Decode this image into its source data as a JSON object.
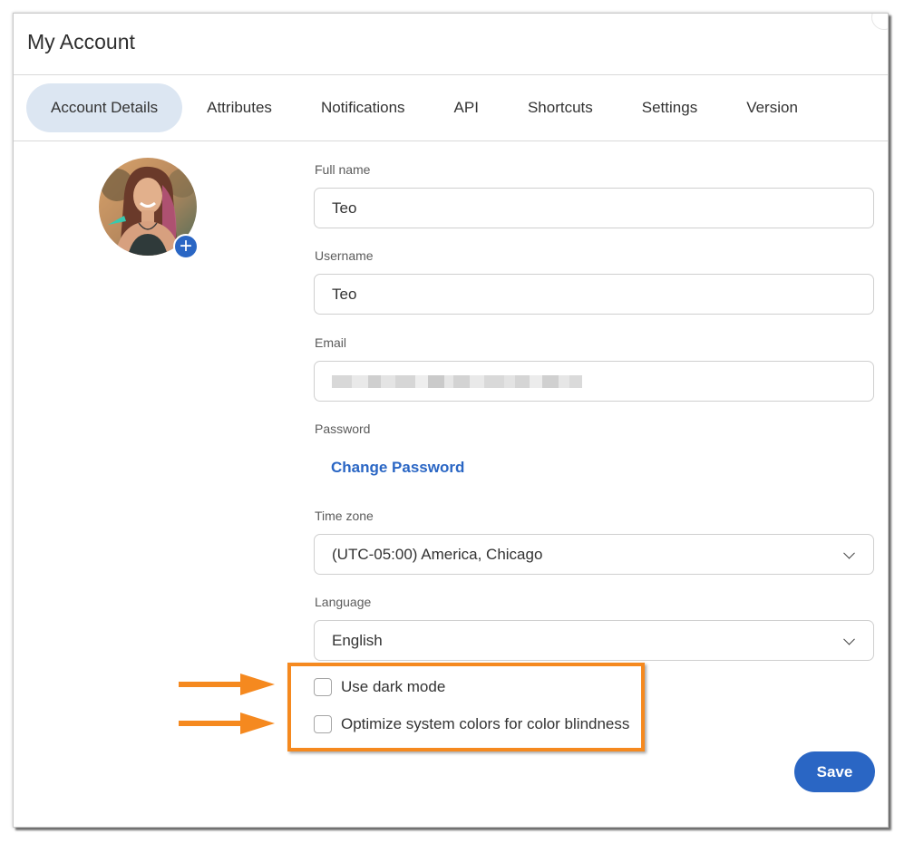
{
  "dialog": {
    "title": "My Account"
  },
  "tabs": [
    {
      "label": "Account Details",
      "active": true
    },
    {
      "label": "Attributes"
    },
    {
      "label": "Notifications"
    },
    {
      "label": "API"
    },
    {
      "label": "Shortcuts"
    },
    {
      "label": "Settings"
    },
    {
      "label": "Version"
    }
  ],
  "form": {
    "full_name": {
      "label": "Full name",
      "value": "Teo"
    },
    "username": {
      "label": "Username",
      "value": "Teo"
    },
    "email": {
      "label": "Email",
      "value": ""
    },
    "password": {
      "label": "Password",
      "link": "Change Password"
    },
    "time_zone": {
      "label": "Time zone",
      "value": "(UTC-05:00) America, Chicago"
    },
    "language": {
      "label": "Language",
      "value": "English"
    },
    "dark_mode": {
      "label": "Use dark mode",
      "checked": false
    },
    "color_blindness": {
      "label": "Optimize system colors for color blindness",
      "checked": false
    },
    "save_label": "Save"
  },
  "icons": {
    "avatar_add": "plus-icon",
    "dropdown": "chevron-down-icon",
    "annotation": "arrow-right-icon"
  },
  "colors": {
    "accent": "#2a66c4",
    "active_tab": "#dce6f2",
    "annotation": "#f5891f"
  }
}
